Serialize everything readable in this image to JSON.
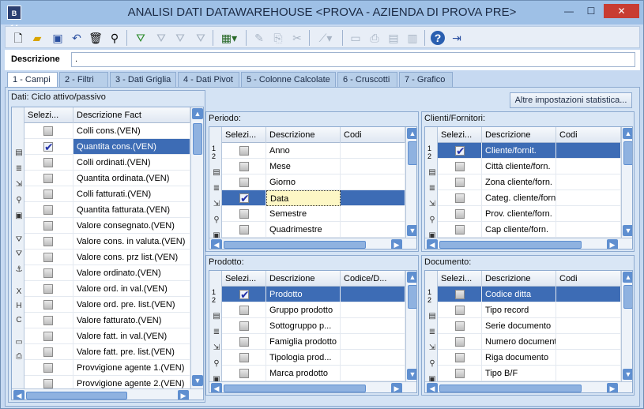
{
  "window": {
    "title": "ANALISI DATI DATAWAREHOUSE <PROVA - AZIENDA DI PROVA PRE>",
    "app_icon": "B 14"
  },
  "descrizione": {
    "label": "Descrizione",
    "value": "."
  },
  "tabs": [
    {
      "label": "1 - Campi"
    },
    {
      "label": "2 - Filtri"
    },
    {
      "label": "3 - Dati Griglia"
    },
    {
      "label": "4 - Dati Pivot"
    },
    {
      "label": "5 - Colonne Calcolate"
    },
    {
      "label": "6 - Cruscotti"
    },
    {
      "label": "7 - Grafico"
    }
  ],
  "altre_button": "Altre impostazioni statistica...",
  "fact_panel": {
    "title": "Dati: Ciclo attivo/passivo",
    "col_sel": "Selezi...",
    "col_desc": "Descrizione Fact",
    "rows": [
      {
        "desc": "Colli cons.(VEN)",
        "checked": false
      },
      {
        "desc": "Quantita cons.(VEN)",
        "checked": true
      },
      {
        "desc": "Colli ordinati.(VEN)",
        "checked": false
      },
      {
        "desc": "Quantita ordinata.(VEN)",
        "checked": false
      },
      {
        "desc": "Colli fatturati.(VEN)",
        "checked": false
      },
      {
        "desc": "Quantita fatturata.(VEN)",
        "checked": false
      },
      {
        "desc": "Valore consegnato.(VEN)",
        "checked": false
      },
      {
        "desc": "Valore cons. in valuta.(VEN)",
        "checked": false
      },
      {
        "desc": "Valore cons. prz list.(VEN)",
        "checked": false
      },
      {
        "desc": "Valore ordinato.(VEN)",
        "checked": false
      },
      {
        "desc": "Valore ord. in val.(VEN)",
        "checked": false
      },
      {
        "desc": "Valore ord. pre. list.(VEN)",
        "checked": false
      },
      {
        "desc": "Valore fatturato.(VEN)",
        "checked": false
      },
      {
        "desc": "Valore fatt. in val.(VEN)",
        "checked": false
      },
      {
        "desc": "Valore fatt. pre. list.(VEN)",
        "checked": false
      },
      {
        "desc": "Provvigione agente 1.(VEN)",
        "checked": false
      },
      {
        "desc": "Provvigione agente 2.(VEN)",
        "checked": false
      }
    ]
  },
  "periodo": {
    "title": "Periodo:",
    "cols": [
      "Selezi...",
      "Descrizione",
      "Codi"
    ],
    "rows": [
      {
        "desc": "Anno",
        "checked": false
      },
      {
        "desc": "Mese",
        "checked": false
      },
      {
        "desc": "Giorno",
        "checked": false
      },
      {
        "desc": "Data",
        "checked": true
      },
      {
        "desc": "Semestre",
        "checked": false
      },
      {
        "desc": "Quadrimestre",
        "checked": false
      }
    ]
  },
  "clienti": {
    "title": "Clienti/Fornitori:",
    "cols": [
      "Selezi...",
      "Descrizione",
      "Codi"
    ],
    "rows": [
      {
        "desc": "Cliente/fornit.",
        "checked": true
      },
      {
        "desc": "Città cliente/forn.",
        "checked": false
      },
      {
        "desc": "Zona cliente/forn.",
        "checked": false
      },
      {
        "desc": "Categ. cliente/forn.",
        "checked": false
      },
      {
        "desc": "Prov. cliente/forn.",
        "checked": false
      },
      {
        "desc": "Cap cliente/forn.",
        "checked": false
      }
    ]
  },
  "prodotto": {
    "title": "Prodotto:",
    "cols": [
      "Selezi...",
      "Descrizione",
      "Codice/D..."
    ],
    "rows": [
      {
        "desc": "Prodotto",
        "checked": true
      },
      {
        "desc": "Gruppo prodotto",
        "checked": false
      },
      {
        "desc": "Sottogruppo p...",
        "checked": false
      },
      {
        "desc": "Famiglia prodotto",
        "checked": false
      },
      {
        "desc": "Tipologia prod...",
        "checked": false
      },
      {
        "desc": "Marca prodotto",
        "checked": false
      }
    ]
  },
  "documento": {
    "title": "Documento:",
    "cols": [
      "Selezi...",
      "Descrizione",
      "Codi"
    ],
    "rows": [
      {
        "desc": "Codice ditta",
        "checked": false
      },
      {
        "desc": "Tipo record",
        "checked": false
      },
      {
        "desc": "Serie documento",
        "checked": false
      },
      {
        "desc": "Numero documento",
        "checked": false
      },
      {
        "desc": "Riga documento",
        "checked": false
      },
      {
        "desc": "Tipo B/F",
        "checked": false
      }
    ]
  },
  "row_numbers": [
    "1",
    "2"
  ]
}
